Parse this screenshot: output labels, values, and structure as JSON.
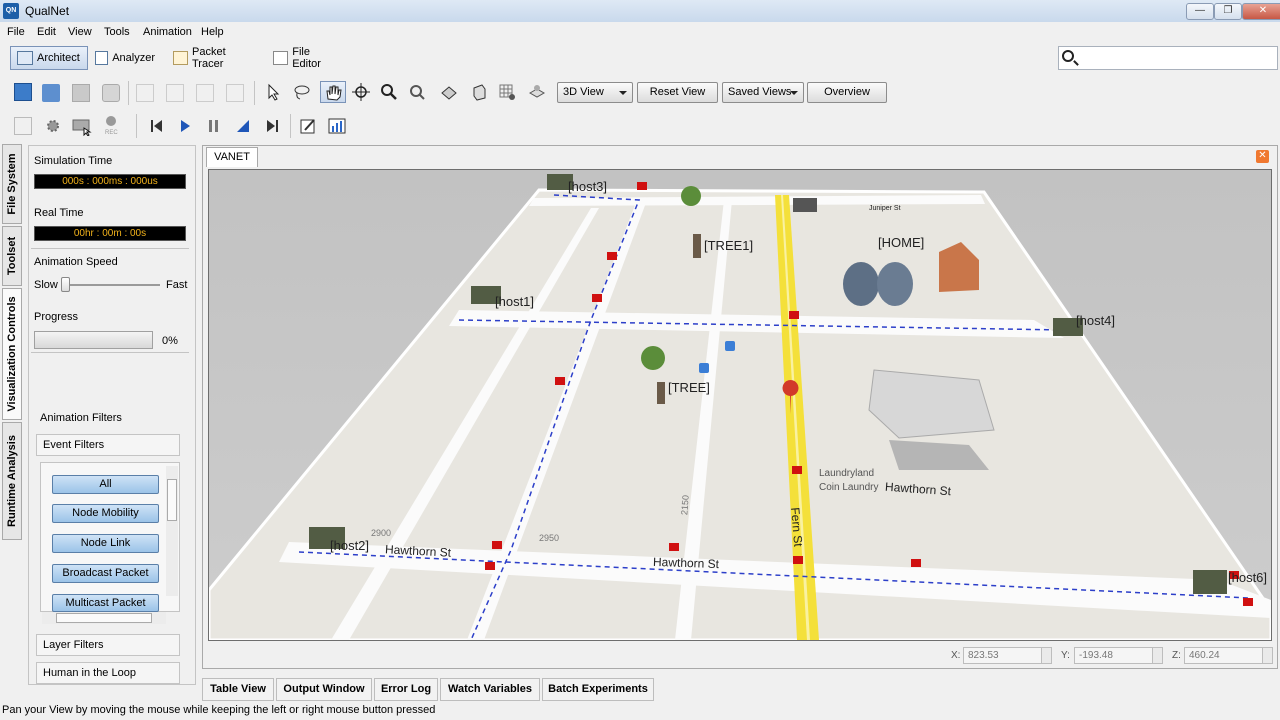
{
  "window": {
    "title": "QualNet",
    "app_icon_text": "QN",
    "minimize": "—",
    "maximize": "❐",
    "close": "✕"
  },
  "menu": [
    "File",
    "Edit",
    "View",
    "Tools",
    "Animation",
    "Help"
  ],
  "perspectives": [
    "Architect",
    "Analyzer",
    "Packet Tracer",
    "File Editor"
  ],
  "toolbar": {
    "view_select": "3D View",
    "reset_view": "Reset View",
    "saved_views": "Saved Views",
    "overview": "Overview"
  },
  "side_tabs": [
    "File System",
    "Toolset",
    "Visualization Controls",
    "Runtime Analysis"
  ],
  "panel": {
    "sim_time_label": "Simulation Time",
    "sim_time_value": "000s : 000ms : 000us",
    "real_time_label": "Real Time",
    "real_time_value": "00hr : 00m : 00s",
    "anim_speed_label": "Animation Speed",
    "slow": "Slow",
    "fast": "Fast",
    "progress_label": "Progress",
    "progress_value": "0%",
    "progress_fraction": 0,
    "animation_filters": "Animation Filters",
    "event_filters": "Event Filters",
    "filters": [
      "All",
      "Node Mobility",
      "Node Link",
      "Broadcast Packet",
      "Multicast Packet"
    ],
    "layer_filters": "Layer Filters",
    "human_in_loop": "Human in the Loop"
  },
  "view": {
    "tab": "VANET",
    "labels": {
      "host3": "[host3]",
      "tree1": "[TREE1]",
      "home": "[HOME]",
      "host1": "[host1]",
      "host4": "[host4]",
      "tree": "[TREE]",
      "host2": "[host2]",
      "host6": "[host6]"
    },
    "streets": {
      "hawthorn": "Hawthorn St",
      "fern": "Fern St",
      "juniper": "Juniper St"
    },
    "map_text": {
      "laundry1": "Laundryland",
      "laundry2": "Coin Laundry",
      "n2950": "2950",
      "n2150": "2150",
      "n2900": "2900"
    }
  },
  "coords": {
    "x_label": "X:",
    "x": "823.53",
    "y_label": "Y:",
    "y": "-193.48",
    "z_label": "Z:",
    "z": "460.24"
  },
  "bottom_tabs": [
    "Table View",
    "Output Window",
    "Error Log",
    "Watch Variables",
    "Batch Experiments"
  ],
  "status": "Pan your View by moving the mouse while keeping the left or right mouse button pressed"
}
